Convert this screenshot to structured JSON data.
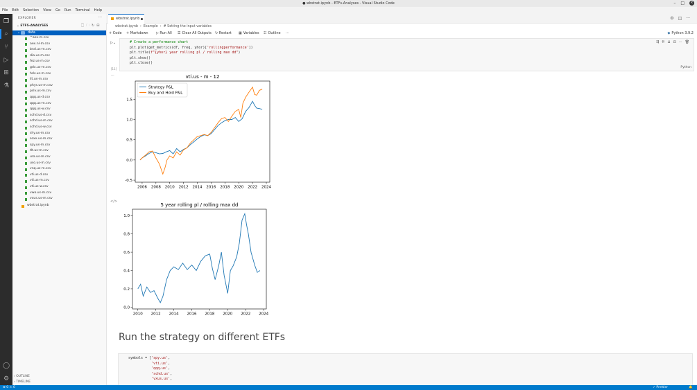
{
  "window": {
    "title": "● wbstrat.ipynb - ETFs-Analyses - Visual Studio Code",
    "menu": [
      "File",
      "Edit",
      "Selection",
      "View",
      "Go",
      "Run",
      "Terminal",
      "Help"
    ]
  },
  "sidebar": {
    "header": "EXPLORER",
    "project": "ETFS-ANALYSES",
    "folder": "data",
    "files": [
      "^aex-m.csv",
      "aex.nl-m.csv",
      "bnd.us-m.csv",
      "dia.us-m.csv",
      "fez.us-m.csv",
      "gdx.us-m.csv",
      "hdv.us-m.csv",
      "ilt.us-m.csv",
      "phys.us-m.csv",
      "pslv.us-m.csv",
      "qqq.us-d.csv",
      "qqq.us-m.csv",
      "qqq.us-w.csv",
      "schd.us-d.csv",
      "schd.us-m.csv",
      "schd.us-w.csv",
      "shy.us-m.csv",
      "soxx.us-m.csv",
      "spy.us-m.csv",
      "tlt.us-m.csv",
      "ura.us-m.csv",
      "uso.us-m.csv",
      "vnq.us-m.csv",
      "vti.us-d.csv",
      "vti.us-m.csv",
      "vti.us-w.csv",
      "vwo.us-m.csv",
      "vxus.us-m.csv"
    ],
    "notebook": "wbstrat.ipynb",
    "outline": "OUTLINE",
    "timeline": "TIMELINE"
  },
  "editor": {
    "tab": "wbstrat.ipynb",
    "breadcrumbs": [
      "wbstrat.ipynb",
      "›",
      "Example",
      "›",
      "# Setting the input variables"
    ],
    "toolbar": {
      "code": "+ Code",
      "markdown": "+ Markdown",
      "run_all": "▷ Run All",
      "clear": "Clear All Outputs",
      "restart": "↻ Restart",
      "variables": "Variables",
      "outline": "Outline",
      "more": "···",
      "kernel": "Python 3.9.2"
    },
    "cell_lang": "Python",
    "exec_count": "[11]",
    "code_lines": [
      "# Create a performance chart",
      "plt.plot(get_metrics(df, freq, yhor)['rollingperformance'])",
      "plt.title(f\"{yhor} year rolling pl / rolling max dd\")",
      "plt.show()",
      "plt.close()"
    ],
    "markdown_heading": "Run the strategy on different ETFs",
    "code2_lines": [
      "symbols = ['spy.us',",
      "           'vti.us',",
      "           'qqq.us',",
      "           'schd.us',",
      "           'vxus.us',"
    ]
  },
  "status": {
    "left": "⊗ 0 ⚠ 0",
    "right": "✓ Prettier"
  },
  "chart_data": [
    {
      "type": "line",
      "title": "vti.us - m - 12",
      "xlabel": "",
      "ylabel": "",
      "xlim": [
        2005,
        2024.5
      ],
      "ylim": [
        -0.55,
        1.95
      ],
      "xticks": [
        2006,
        2008,
        2010,
        2012,
        2014,
        2016,
        2018,
        2020,
        2022,
        2024
      ],
      "yticks": [
        -0.5,
        0.0,
        0.5,
        1.0,
        1.5
      ],
      "legend": "top-left",
      "series": [
        {
          "name": "Strategy P&L",
          "color": "#1f77b4",
          "x": [
            2005.7,
            2006,
            2006.5,
            2007,
            2007.5,
            2008,
            2008.5,
            2009,
            2009.5,
            2010,
            2010.5,
            2011,
            2011.5,
            2012,
            2012.5,
            2013,
            2013.5,
            2014,
            2014.5,
            2015,
            2015.5,
            2016,
            2016.5,
            2017,
            2017.5,
            2018,
            2018.5,
            2019,
            2019.5,
            2020,
            2020.5,
            2021,
            2021.5,
            2022,
            2022.3,
            2022.6,
            2023,
            2023.4
          ],
          "y": [
            0.0,
            0.05,
            0.1,
            0.16,
            0.2,
            0.18,
            0.15,
            0.16,
            0.2,
            0.23,
            0.15,
            0.28,
            0.2,
            0.26,
            0.3,
            0.38,
            0.45,
            0.52,
            0.58,
            0.62,
            0.6,
            0.65,
            0.75,
            0.85,
            0.92,
            0.97,
            1.0,
            1.0,
            1.05,
            0.95,
            1.02,
            1.2,
            1.3,
            1.45,
            1.35,
            1.28,
            1.27,
            1.25
          ]
        },
        {
          "name": "Buy and Hold P&L",
          "color": "#ff7f0e",
          "x": [
            2005.7,
            2006,
            2006.5,
            2007,
            2007.5,
            2008,
            2008.5,
            2009,
            2009.3,
            2009.6,
            2010,
            2010.5,
            2011,
            2011.5,
            2012,
            2012.5,
            2013,
            2013.5,
            2014,
            2014.5,
            2015,
            2015.5,
            2016,
            2016.5,
            2017,
            2017.5,
            2018,
            2018.5,
            2019,
            2019.5,
            2020,
            2020.3,
            2020.6,
            2021,
            2021.5,
            2022,
            2022.3,
            2022.6,
            2023,
            2023.4
          ],
          "y": [
            0.0,
            0.05,
            0.12,
            0.2,
            0.22,
            0.05,
            -0.1,
            -0.35,
            -0.2,
            0.0,
            0.1,
            0.05,
            0.2,
            0.12,
            0.25,
            0.3,
            0.42,
            0.5,
            0.58,
            0.6,
            0.63,
            0.6,
            0.68,
            0.8,
            0.92,
            1.02,
            1.05,
            0.95,
            1.08,
            1.2,
            1.25,
            1.05,
            1.4,
            1.55,
            1.68,
            1.8,
            1.62,
            1.6,
            1.72,
            1.75
          ]
        }
      ]
    },
    {
      "type": "line",
      "title": "5 year rolling pl / rolling max dd",
      "xlabel": "",
      "ylabel": "",
      "xlim": [
        2009.4,
        2024.3
      ],
      "ylim": [
        -0.02,
        1.07
      ],
      "xticks": [
        2010,
        2012,
        2014,
        2016,
        2018,
        2020,
        2022,
        2024
      ],
      "yticks": [
        0.0,
        0.2,
        0.4,
        0.6,
        0.8,
        1.0
      ],
      "series": [
        {
          "name": "",
          "color": "#1f77b4",
          "x": [
            2010,
            2010.3,
            2010.6,
            2011,
            2011.4,
            2011.8,
            2012.2,
            2012.5,
            2012.8,
            2013.2,
            2013.6,
            2014,
            2014.5,
            2015,
            2015.5,
            2016,
            2016.5,
            2017,
            2017.5,
            2018,
            2018.3,
            2018.6,
            2019,
            2019.3,
            2019.6,
            2020,
            2020.3,
            2020.6,
            2021,
            2021.3,
            2021.6,
            2021.9,
            2022.1,
            2022.3,
            2022.6,
            2023,
            2023.3,
            2023.6
          ],
          "y": [
            0.2,
            0.25,
            0.12,
            0.22,
            0.16,
            0.18,
            0.1,
            0.05,
            0.12,
            0.3,
            0.4,
            0.44,
            0.41,
            0.48,
            0.41,
            0.46,
            0.4,
            0.5,
            0.56,
            0.58,
            0.42,
            0.3,
            0.45,
            0.6,
            0.35,
            0.15,
            0.4,
            0.45,
            0.55,
            0.7,
            0.95,
            1.02,
            0.9,
            0.8,
            0.6,
            0.46,
            0.38,
            0.4
          ]
        }
      ]
    }
  ]
}
